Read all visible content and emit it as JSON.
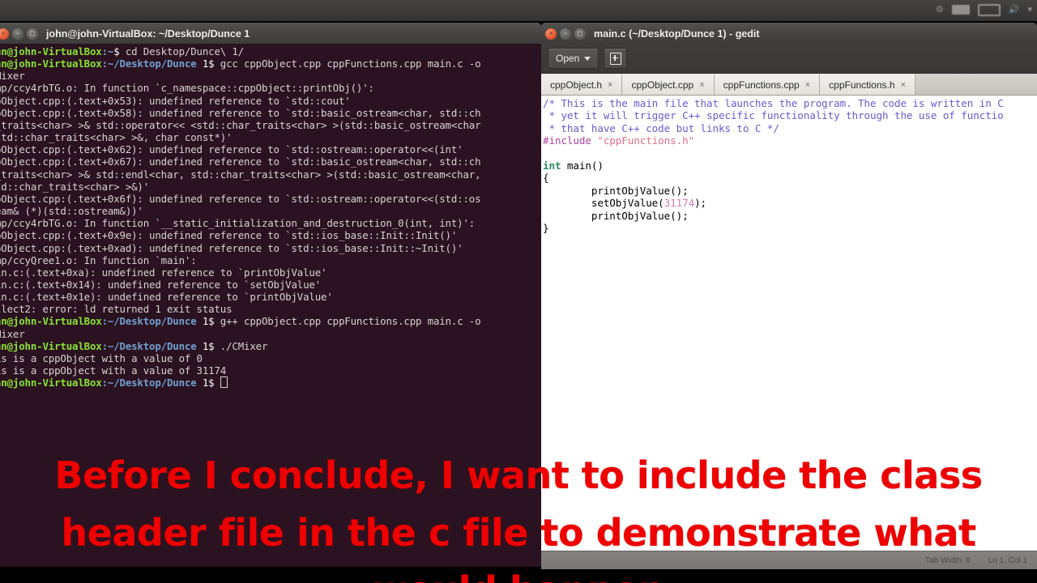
{
  "desktop": {
    "panel": {
      "indicators": [
        "bluetooth-icon",
        "keyboard-icon",
        "battery-icon",
        "volume-icon",
        "power-icon"
      ]
    }
  },
  "terminal": {
    "window_title": "john@john-VirtualBox: ~/Desktop/Dunce 1",
    "buttons": {
      "close": "close-button",
      "minimize": "minimize-button",
      "maximize": "maximize-button"
    },
    "background_color": "#2b1220",
    "prompt_user_color": "#8ae234",
    "prompt_path_color": "#729fcf",
    "lines": [
      {
        "prompt_user": "hn@john-VirtualBox",
        "prompt_path": ":~",
        "prompt_tail": "$ ",
        "text": "cd Desktop/Dunce\\ 1/"
      },
      {
        "prompt_user": "hn@john-VirtualBox",
        "prompt_path": ":~/Desktop/Dunce",
        "prompt_tail": " 1$ ",
        "text": "gcc cppObject.cpp cppFunctions.cpp main.c -o"
      },
      {
        "text": "Mixer"
      },
      {
        "text": "mp/ccy4rbTG.o: In function `c_namespace::cppObject::printObj()':"
      },
      {
        "text": "pObject.cpp:(.text+0x53): undefined reference to `std::cout'"
      },
      {
        "text": "pObject.cpp:(.text+0x58): undefined reference to `std::basic_ostream<char, std::ch"
      },
      {
        "text": "_traits<char> >& std::operator<< <std::char_traits<char> >(std::basic_ostream<char"
      },
      {
        "text": "std::char_traits<char> >&, char const*)'"
      },
      {
        "text": "pObject.cpp:(.text+0x62): undefined reference to `std::ostream::operator<<(int'"
      },
      {
        "text": "pObject.cpp:(.text+0x67): undefined reference to `std::basic_ostream<char, std::ch"
      },
      {
        "text": "_traits<char> >& std::endl<char, std::char_traits<char> >(std::basic_ostream<char,"
      },
      {
        "text": "td::char_traits<char> >&)'"
      },
      {
        "text": "pObject.cpp:(.text+0x6f): undefined reference to `std::ostream::operator<<(std::os"
      },
      {
        "text": "eam& (*)(std::ostream&))'"
      },
      {
        "text": "mp/ccy4rbTG.o: In function `__static_initialization_and_destruction_0(int, int)':"
      },
      {
        "text": "pObject.cpp:(.text+0x9e): undefined reference to `std::ios_base::Init::Init()'"
      },
      {
        "text": "pObject.cpp:(.text+0xad): undefined reference to `std::ios_base::Init::~Init()'"
      },
      {
        "text": "mp/ccyQree1.o: In function `main':"
      },
      {
        "text": "in.c:(.text+0xa): undefined reference to `printObjValue'"
      },
      {
        "text": "in.c:(.text+0x14): undefined reference to `setObjValue'"
      },
      {
        "text": "in.c:(.text+0x1e): undefined reference to `printObjValue'"
      },
      {
        "text": "llect2: error: ld returned 1 exit status"
      },
      {
        "prompt_user": "hn@john-VirtualBox",
        "prompt_path": ":~/Desktop/Dunce",
        "prompt_tail": " 1$ ",
        "text": "g++ cppObject.cpp cppFunctions.cpp main.c -o"
      },
      {
        "text": "Mixer"
      },
      {
        "prompt_user": "hn@john-VirtualBox",
        "prompt_path": ":~/Desktop/Dunce",
        "prompt_tail": " 1$ ",
        "text": "./CMixer"
      },
      {
        "text": "is is a cppObject with a value of 0"
      },
      {
        "text": "is is a cppObject with a value of 31174"
      },
      {
        "prompt_user": "hn@john-VirtualBox",
        "prompt_path": ":~/Desktop/Dunce",
        "prompt_tail": " 1$ ",
        "text": "",
        "cursor": true
      }
    ]
  },
  "gedit": {
    "window_title": "main.c (~/Desktop/Dunce 1) - gedit",
    "toolbar": {
      "open_label": "Open",
      "open_icon": "chevron-down-icon",
      "new_document_icon": "new-document-icon"
    },
    "tabs": [
      {
        "label": "cppObject.h",
        "close": "×"
      },
      {
        "label": "cppObject.cpp",
        "close": "×"
      },
      {
        "label": "cppFunctions.cpp",
        "close": "×"
      },
      {
        "label": "cppFunctions.h",
        "close": "×"
      }
    ],
    "code_lines": [
      [
        {
          "t": "/* This is the main file that launches the program. The code is written in C",
          "c": "comment"
        }
      ],
      [
        {
          "t": " * yet it will trigger C++ specific functionality through the use of functio",
          "c": "comment"
        }
      ],
      [
        {
          "t": " * that have C++ code but links to C */",
          "c": "comment"
        }
      ],
      [
        {
          "t": "#include ",
          "c": "pre"
        },
        {
          "t": "\"cppFunctions.h\"",
          "c": "string"
        }
      ],
      [
        {
          "t": "",
          "c": "plain"
        }
      ],
      [
        {
          "t": "int",
          "c": "type"
        },
        {
          "t": " main()",
          "c": "plain"
        }
      ],
      [
        {
          "t": "{",
          "c": "plain"
        }
      ],
      [
        {
          "t": "        printObjValue();",
          "c": "plain"
        }
      ],
      [
        {
          "t": "        setObjValue(",
          "c": "plain"
        },
        {
          "t": "31174",
          "c": "num"
        },
        {
          "t": ");",
          "c": "plain"
        }
      ],
      [
        {
          "t": "        printObjValue();",
          "c": "plain"
        }
      ],
      [
        {
          "t": "}",
          "c": "plain"
        }
      ]
    ],
    "statusbar": {
      "tab_width": "Tab Width: 8",
      "position": "Ln 1, Col 1"
    }
  },
  "subtitle": {
    "color": "#ee0000",
    "lines": [
      "Before I conclude, I want to include the class",
      "header file in the c file to demonstrate what",
      "would happen"
    ]
  }
}
